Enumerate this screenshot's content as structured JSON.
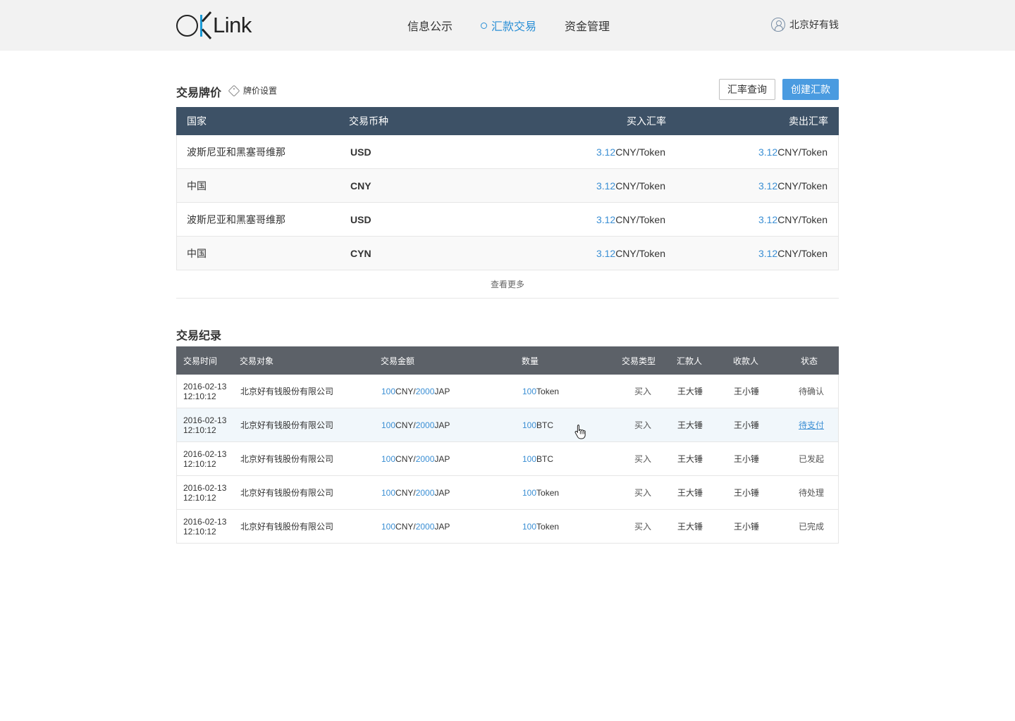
{
  "header": {
    "logo_text": "Link",
    "nav": [
      {
        "label": "信息公示",
        "active": false
      },
      {
        "label": "汇款交易",
        "active": true
      },
      {
        "label": "资金管理",
        "active": false
      }
    ],
    "user_name": "北京好有钱"
  },
  "rates": {
    "title": "交易牌价",
    "settings_link": "牌价设置",
    "btn_query": "汇率查询",
    "btn_create": "创建汇款",
    "columns": [
      "国家",
      "交易币种",
      "买入汇率",
      "卖出汇率"
    ],
    "rows": [
      {
        "country": "波斯尼亚和黑塞哥维那",
        "currency": "USD",
        "buy_value": "3.12",
        "buy_unit": "CNY/Token",
        "sell_value": "3.12",
        "sell_unit": "CNY/Token"
      },
      {
        "country": "中国",
        "currency": "CNY",
        "buy_value": "3.12",
        "buy_unit": "CNY/Token",
        "sell_value": "3.12",
        "sell_unit": "CNY/Token"
      },
      {
        "country": "波斯尼亚和黑塞哥维那",
        "currency": "USD",
        "buy_value": "3.12",
        "buy_unit": "CNY/Token",
        "sell_value": "3.12",
        "sell_unit": "CNY/Token"
      },
      {
        "country": "中国",
        "currency": "CYN",
        "buy_value": "3.12",
        "buy_unit": "CNY/Token",
        "sell_value": "3.12",
        "sell_unit": "CNY/Token"
      }
    ],
    "more": "查看更多"
  },
  "records": {
    "title": "交易纪录",
    "columns": [
      "交易时间",
      "交易对象",
      "交易金额",
      "数量",
      "交易类型",
      "汇款人",
      "收款人",
      "状态"
    ],
    "rows": [
      {
        "date": "2016-02-13",
        "time": "12:10:12",
        "party": "北京好有钱股份有限公司",
        "amt1": "100",
        "cur1": "CNY/",
        "amt2": "2000",
        "cur2": "JAP",
        "qty": "100",
        "qty_unit": "Token",
        "type": "买入",
        "sender": "王大锤",
        "receiver": "王小锤",
        "status": "待确认"
      },
      {
        "date": "2016-02-13",
        "time": "12:10:12",
        "party": "北京好有钱股份有限公司",
        "amt1": "100",
        "cur1": "CNY/",
        "amt2": "2000",
        "cur2": "JAP",
        "qty": "100",
        "qty_unit": "BTC",
        "type": "买入",
        "sender": "王大锤",
        "receiver": "王小锤",
        "status": "待支付"
      },
      {
        "date": "2016-02-13",
        "time": "12:10:12",
        "party": "北京好有钱股份有限公司",
        "amt1": "100",
        "cur1": "CNY/",
        "amt2": "2000",
        "cur2": "JAP",
        "qty": "100",
        "qty_unit": "BTC",
        "type": "买入",
        "sender": "王大锤",
        "receiver": "王小锤",
        "status": "已发起"
      },
      {
        "date": "2016-02-13",
        "time": "12:10:12",
        "party": "北京好有钱股份有限公司",
        "amt1": "100",
        "cur1": "CNY/",
        "amt2": "2000",
        "cur2": "JAP",
        "qty": "100",
        "qty_unit": "Token",
        "type": "买入",
        "sender": "王大锤",
        "receiver": "王小锤",
        "status": "待处理"
      },
      {
        "date": "2016-02-13",
        "time": "12:10:12",
        "party": "北京好有钱股份有限公司",
        "amt1": "100",
        "cur1": "CNY/",
        "amt2": "2000",
        "cur2": "JAP",
        "qty": "100",
        "qty_unit": "Token",
        "type": "买入",
        "sender": "王大锤",
        "receiver": "王小锤",
        "status": "已完成"
      }
    ]
  },
  "colors": {
    "accent": "#3b8fd4",
    "header_bg": "#f2f2f2",
    "table1_head": "#3d5166",
    "table2_head": "#5c6168",
    "primary_btn": "#4a9be0"
  }
}
